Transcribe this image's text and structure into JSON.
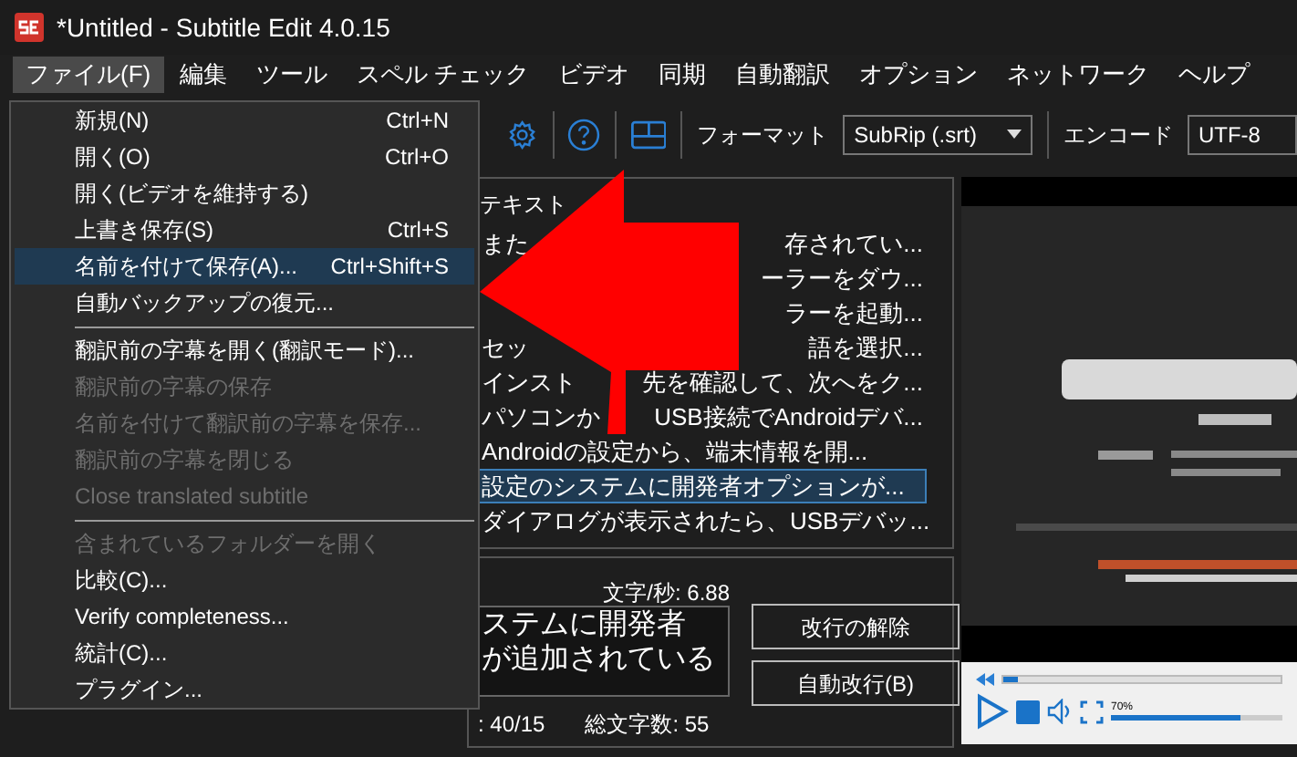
{
  "window": {
    "title": "*Untitled - Subtitle Edit 4.0.15"
  },
  "menu_bar": [
    {
      "label": "ファイル(F)",
      "selected": true
    },
    {
      "label": "編集",
      "selected": false
    },
    {
      "label": "ツール",
      "selected": false
    },
    {
      "label": "スペル チェック",
      "selected": false
    },
    {
      "label": "ビデオ",
      "selected": false
    },
    {
      "label": "同期",
      "selected": false
    },
    {
      "label": "自動翻訳",
      "selected": false
    },
    {
      "label": "オプション",
      "selected": false
    },
    {
      "label": "ネットワーク",
      "selected": false
    },
    {
      "label": "ヘルプ",
      "selected": false
    }
  ],
  "file_menu": [
    {
      "kind": "item",
      "label": "新規(N)",
      "shortcut": "Ctrl+N",
      "disabled": false,
      "selected": false
    },
    {
      "kind": "item",
      "label": "開く(O)",
      "shortcut": "Ctrl+O",
      "disabled": false,
      "selected": false
    },
    {
      "kind": "item",
      "label": "開く(ビデオを維持する)",
      "disabled": false,
      "selected": false
    },
    {
      "kind": "item",
      "label": "上書き保存(S)",
      "shortcut": "Ctrl+S",
      "disabled": false,
      "selected": false
    },
    {
      "kind": "item",
      "label": "名前を付けて保存(A)...",
      "shortcut": "Ctrl+Shift+S",
      "disabled": false,
      "selected": true
    },
    {
      "kind": "item",
      "label": "自動バックアップの復元...",
      "disabled": false,
      "selected": false
    },
    {
      "kind": "separator"
    },
    {
      "kind": "item",
      "label": "翻訳前の字幕を開く(翻訳モード)...",
      "disabled": false,
      "selected": false
    },
    {
      "kind": "item",
      "label": "翻訳前の字幕の保存",
      "disabled": true,
      "selected": false
    },
    {
      "kind": "item",
      "label": "名前を付けて翻訳前の字幕を保存...",
      "disabled": true,
      "selected": false
    },
    {
      "kind": "item",
      "label": "翻訳前の字幕を閉じる",
      "disabled": true,
      "selected": false
    },
    {
      "kind": "item",
      "label": "Close translated subtitle",
      "disabled": true,
      "selected": false
    },
    {
      "kind": "separator"
    },
    {
      "kind": "item",
      "label": "含まれているフォルダーを開く",
      "disabled": true,
      "selected": false
    },
    {
      "kind": "item",
      "label": "比較(C)...",
      "disabled": false,
      "selected": false
    },
    {
      "kind": "item",
      "label": "Verify completeness...",
      "disabled": false,
      "selected": false
    },
    {
      "kind": "item",
      "label": "統計(C)...",
      "disabled": false,
      "selected": false
    },
    {
      "kind": "item",
      "label": "プラグイン...",
      "disabled": false,
      "selected": false
    }
  ],
  "toolbar": {
    "format_label": "フォーマット",
    "format_value": "SubRip (.srt)",
    "encoding_label": "エンコード",
    "encoding_value": "UTF-8"
  },
  "subtitle_list": {
    "header": "テキスト",
    "rows": [
      {
        "segments": [
          "また",
          "存されてい..."
        ],
        "selected": false
      },
      {
        "segments": [
          "ーラーをダウ..."
        ],
        "selected": false
      },
      {
        "segments": [
          "ラーを起動..."
        ],
        "selected": false
      },
      {
        "segments": [
          "セッ",
          "語を選択..."
        ],
        "selected": false
      },
      {
        "segments": [
          "インスト",
          "先を確認して、次へをク..."
        ],
        "selected": false
      },
      {
        "segments": [
          "パソコンか",
          "USB接続でAndroidデバ..."
        ],
        "selected": false
      },
      {
        "segments": [
          "Androidの設定から、端末情報を開..."
        ],
        "selected": false
      },
      {
        "segments": [
          "設定のシステムに開発者オプションが..."
        ],
        "selected": true
      },
      {
        "segments": [
          "ダイアログが表示されたら、USBデバッ..."
        ],
        "selected": false
      }
    ]
  },
  "editor": {
    "chars_per_sec": "文字/秒: 6.88",
    "text_lines": [
      "ステムに開発者",
      "が追加されている"
    ],
    "line_length": ": 40/15",
    "total_chars": "総文字数: 55",
    "buttons": [
      "改行の解除",
      "自動改行(B)"
    ]
  },
  "video": {
    "kind": "picture",
    "seek": {
      "level": 0.05
    },
    "volume": {
      "level": 0.75,
      "reading": "70%"
    }
  }
}
